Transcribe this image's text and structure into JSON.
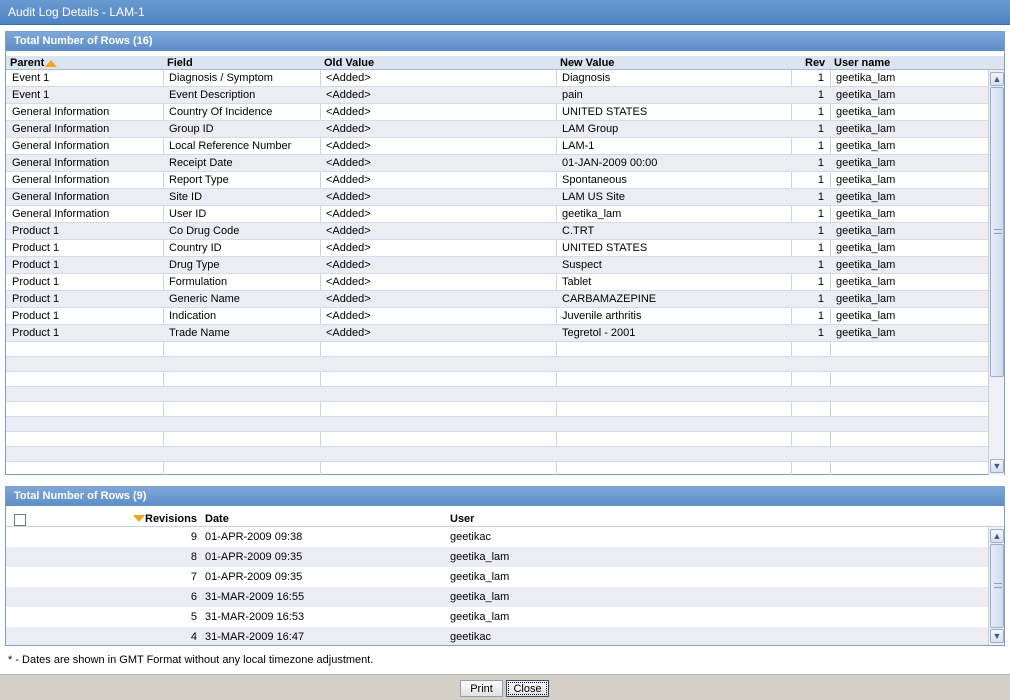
{
  "window": {
    "title": "Audit Log Details - LAM-1"
  },
  "audit_panel": {
    "title": "Total Number of Rows (16)",
    "columns": {
      "parent": "Parent",
      "field": "Field",
      "old_value": "Old Value",
      "new_value": "New Value",
      "rev": "Rev",
      "user": "User name"
    },
    "sort_icon": "sort-ascending-icon",
    "rows": [
      {
        "parent": "Event 1",
        "field": "Diagnosis / Symptom",
        "old": "<Added>",
        "new": "Diagnosis",
        "rev": "1",
        "user": "geetika_lam"
      },
      {
        "parent": "Event 1",
        "field": "Event Description",
        "old": "<Added>",
        "new": "pain",
        "rev": "1",
        "user": "geetika_lam"
      },
      {
        "parent": "General Information",
        "field": "Country Of Incidence",
        "old": "<Added>",
        "new": "UNITED STATES",
        "rev": "1",
        "user": "geetika_lam"
      },
      {
        "parent": "General Information",
        "field": "Group ID",
        "old": "<Added>",
        "new": "LAM Group",
        "rev": "1",
        "user": "geetika_lam"
      },
      {
        "parent": "General Information",
        "field": "Local Reference Number",
        "old": "<Added>",
        "new": "LAM-1",
        "rev": "1",
        "user": "geetika_lam"
      },
      {
        "parent": "General Information",
        "field": "Receipt Date",
        "old": "<Added>",
        "new": "01-JAN-2009 00:00",
        "rev": "1",
        "user": "geetika_lam"
      },
      {
        "parent": "General Information",
        "field": "Report Type",
        "old": "<Added>",
        "new": "Spontaneous",
        "rev": "1",
        "user": "geetika_lam"
      },
      {
        "parent": "General Information",
        "field": "Site ID",
        "old": "<Added>",
        "new": "LAM US Site",
        "rev": "1",
        "user": "geetika_lam"
      },
      {
        "parent": "General Information",
        "field": "User ID",
        "old": "<Added>",
        "new": "geetika_lam",
        "rev": "1",
        "user": "geetika_lam"
      },
      {
        "parent": "Product 1",
        "field": "Co Drug Code",
        "old": "<Added>",
        "new": "C.TRT",
        "rev": "1",
        "user": "geetika_lam"
      },
      {
        "parent": "Product 1",
        "field": "Country ID",
        "old": "<Added>",
        "new": "UNITED STATES",
        "rev": "1",
        "user": "geetika_lam"
      },
      {
        "parent": "Product 1",
        "field": "Drug Type",
        "old": "<Added>",
        "new": "Suspect",
        "rev": "1",
        "user": "geetika_lam"
      },
      {
        "parent": "Product 1",
        "field": "Formulation",
        "old": "<Added>",
        "new": "Tablet",
        "rev": "1",
        "user": "geetika_lam"
      },
      {
        "parent": "Product 1",
        "field": "Generic Name",
        "old": "<Added>",
        "new": "CARBAMAZEPINE",
        "rev": "1",
        "user": "geetika_lam"
      },
      {
        "parent": "Product 1",
        "field": "Indication",
        "old": "<Added>",
        "new": "Juvenile arthritis",
        "rev": "1",
        "user": "geetika_lam"
      },
      {
        "parent": "Product 1",
        "field": "Trade Name",
        "old": "<Added>",
        "new": "Tegretol - 2001",
        "rev": "1",
        "user": "geetika_lam"
      }
    ]
  },
  "revisions_panel": {
    "title": "Total Number of Rows (9)",
    "columns": {
      "revisions": "Revisions",
      "date": "Date",
      "user": "User"
    },
    "sort_icon": "sort-descending-icon",
    "rows": [
      {
        "rev": "9",
        "date": "01-APR-2009 09:38",
        "user": "geetikac"
      },
      {
        "rev": "8",
        "date": "01-APR-2009 09:35",
        "user": "geetika_lam"
      },
      {
        "rev": "7",
        "date": "01-APR-2009 09:35",
        "user": "geetika_lam"
      },
      {
        "rev": "6",
        "date": "31-MAR-2009 16:55",
        "user": "geetika_lam"
      },
      {
        "rev": "5",
        "date": "31-MAR-2009 16:53",
        "user": "geetika_lam"
      },
      {
        "rev": "4",
        "date": "31-MAR-2009 16:47",
        "user": "geetikac"
      }
    ]
  },
  "footnote": "* - Dates are shown in GMT Format without any local timezone adjustment.",
  "buttons": {
    "print": "Print",
    "close": "Close"
  }
}
